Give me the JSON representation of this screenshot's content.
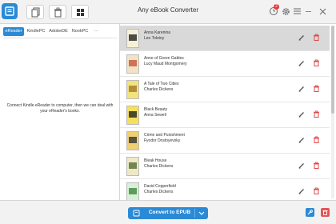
{
  "app": {
    "title": "Any eBook Converter",
    "history_badge": "2",
    "accent_color": "#2b8ad6"
  },
  "toolbar": {
    "icons": [
      "add-files-icon",
      "delete-icon",
      "grid-view-icon"
    ]
  },
  "left_panel": {
    "tabs": [
      {
        "label": "eReader",
        "active": true
      },
      {
        "label": "KindlePC",
        "active": false
      },
      {
        "label": "AdobeDE",
        "active": false
      },
      {
        "label": "NookPC",
        "active": false
      },
      {
        "label": "···",
        "active": false
      }
    ],
    "message": "Connect Kindle eReader to computer, then we can deal with your eReader's books."
  },
  "books": [
    {
      "title": "Anna Karenina",
      "author": "Leo Tolstoy",
      "selected": true,
      "cover_color": "#f5f0d8",
      "cover_accent": "#222222"
    },
    {
      "title": "Anne of Green Gables",
      "author": "Lucy Maud Montgomery",
      "selected": false,
      "cover_color": "#f2e3c7",
      "cover_accent": "#c7553a"
    },
    {
      "title": "A Tale of Two Cities",
      "author": "Charles Dickens",
      "selected": false,
      "cover_color": "#f4e27a",
      "cover_accent": "#a07a2a"
    },
    {
      "title": "Black Beauty",
      "author": "Anna Sewell",
      "selected": false,
      "cover_color": "#f4e05a",
      "cover_accent": "#222222"
    },
    {
      "title": "Crime and Punishment",
      "author": "Fyodor Dostoyevsky",
      "selected": false,
      "cover_color": "#f0d070",
      "cover_accent": "#333333"
    },
    {
      "title": "Bleak House",
      "author": "Charles Dickens",
      "selected": false,
      "cover_color": "#eee8c8",
      "cover_accent": "#556b2f"
    },
    {
      "title": "David Copperfield",
      "author": "Charles Dickens",
      "selected": false,
      "cover_color": "#d9efd9",
      "cover_accent": "#3a8a3a"
    }
  ],
  "bottom": {
    "convert_label": "Convert to EPUB"
  }
}
